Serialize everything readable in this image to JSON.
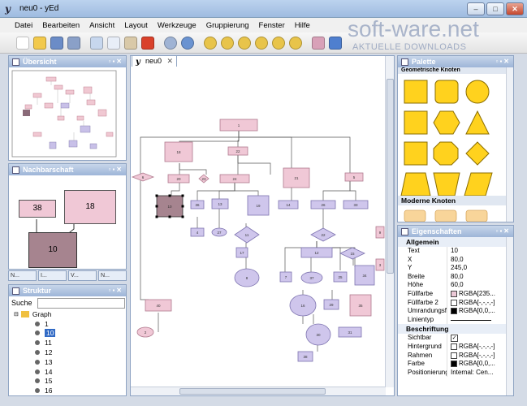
{
  "window": {
    "title": "neu0 - yEd",
    "min": "–",
    "max": "□",
    "close": "✕"
  },
  "menu": [
    "Datei",
    "Bearbeiten",
    "Ansicht",
    "Layout",
    "Werkzeuge",
    "Gruppierung",
    "Fenster",
    "Hilfe"
  ],
  "watermark": {
    "main": "soft-ware.net",
    "sub": "AKTUELLE DOWNLOADS"
  },
  "panels": {
    "overview": "Übersicht",
    "neighborhood": "Nachbarschaft",
    "structure": "Struktur",
    "palette": "Palette",
    "properties": "Eigenschaften"
  },
  "neighborhood_nodes": {
    "a": "38",
    "b": "18",
    "c": "10"
  },
  "mini_tabs": [
    "N...",
    "I...",
    "V...",
    "N..."
  ],
  "structure": {
    "search_label": "Suche",
    "root": "Graph",
    "items": [
      "1",
      "10",
      "11",
      "12",
      "13",
      "14",
      "15",
      "16"
    ],
    "selected": "10"
  },
  "document_tab": "neu0",
  "palette": {
    "section1": "Geometrische Knoten",
    "section2": "Moderne Knoten",
    "fill": "#ffd21e"
  },
  "properties": {
    "section_general": "Allgemein",
    "general": [
      {
        "key": "Text",
        "value": "10"
      },
      {
        "key": "X",
        "value": "80,0"
      },
      {
        "key": "Y",
        "value": "245,0"
      },
      {
        "key": "Breite",
        "value": "80,0"
      },
      {
        "key": "Höhe",
        "value": "60,0"
      },
      {
        "key": "Füllfarbe",
        "value": "RGBA[235..."
      },
      {
        "key": "Füllfarbe 2",
        "value": "RGBA[-,-,-,-]"
      },
      {
        "key": "Umrandungsf...",
        "value": "RGBA[0,0,..."
      },
      {
        "key": "Linientyp",
        "value": ""
      }
    ],
    "section_label": "Beschriftung",
    "label": [
      {
        "key": "Sichtbar",
        "value": "✓"
      },
      {
        "key": "Hintergrund",
        "value": "RGBA[-,-,-,-]"
      },
      {
        "key": "Rahmen",
        "value": "RGBA[-,-,-,-]"
      },
      {
        "key": "Farbe",
        "value": "RGBA[0,0,..."
      },
      {
        "key": "Positionierung",
        "value": "Internal: Cen..."
      }
    ]
  },
  "graph_nodes": [
    {
      "label": "1"
    },
    {
      "label": "18"
    },
    {
      "label": "22"
    },
    {
      "label": "6"
    },
    {
      "label": "20"
    },
    {
      "label": "23"
    },
    {
      "label": "24"
    },
    {
      "label": "21"
    },
    {
      "label": "5"
    },
    {
      "label": "10"
    },
    {
      "label": "36"
    },
    {
      "label": "13"
    },
    {
      "label": "19"
    },
    {
      "label": "14"
    },
    {
      "label": "26"
    },
    {
      "label": "33"
    },
    {
      "label": "4"
    },
    {
      "label": "27"
    },
    {
      "label": "11"
    },
    {
      "label": "22"
    },
    {
      "label": "17"
    },
    {
      "label": "8"
    },
    {
      "label": "12"
    },
    {
      "label": "15"
    },
    {
      "label": "7"
    },
    {
      "label": "37"
    },
    {
      "label": "25"
    },
    {
      "label": "34"
    },
    {
      "label": "16"
    },
    {
      "label": "40"
    },
    {
      "label": "29"
    },
    {
      "label": "35"
    },
    {
      "label": "2"
    },
    {
      "label": "30"
    },
    {
      "label": "31"
    },
    {
      "label": "9"
    },
    {
      "label": "38"
    },
    {
      "label": "3"
    }
  ]
}
